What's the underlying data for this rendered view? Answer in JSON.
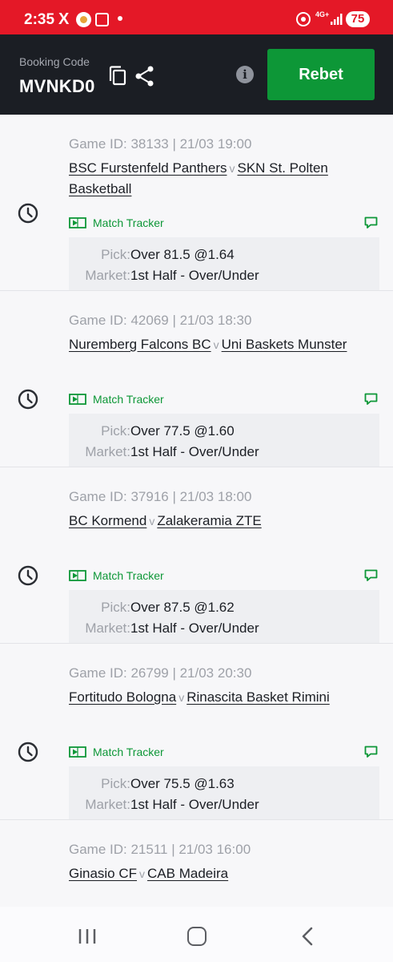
{
  "status_bar": {
    "time": "2:35",
    "x_glyph": "X",
    "network": "4G+",
    "battery": "75"
  },
  "header": {
    "booking_label": "Booking Code",
    "booking_code": "MVNKD0",
    "rebet_label": "Rebet",
    "info_glyph": "i"
  },
  "icons": {
    "clock": "clock-icon",
    "copy": "copy-icon",
    "share": "share-icon",
    "info": "info-icon",
    "tracker": "match-tracker-icon",
    "chat": "chat-icon"
  },
  "colors": {
    "accent_red": "#e41827",
    "header_bg": "#1b1e24",
    "green": "#0d9737"
  },
  "bets": [
    {
      "game_id": "Game ID: 38133 | 21/03 19:00",
      "home": "BSC Furstenfeld Panthers",
      "vs": "v",
      "away": "SKN St. Polten Basketball",
      "tracker": "Match Tracker",
      "pick_label": "Pick:",
      "pick": "Over 81.5 @1.64",
      "market_label": "Market:",
      "market": "1st Half - Over/Under"
    },
    {
      "game_id": "Game ID: 42069 | 21/03 18:30",
      "home": "Nuremberg Falcons BC",
      "vs": "v",
      "away": "Uni Baskets Munster",
      "tracker": "Match Tracker",
      "pick_label": "Pick:",
      "pick": "Over 77.5 @1.60",
      "market_label": "Market:",
      "market": "1st Half - Over/Under"
    },
    {
      "game_id": "Game ID: 37916 | 21/03 18:00",
      "home": "BC Kormend",
      "vs": "v",
      "away": "Zalakeramia ZTE",
      "tracker": "Match Tracker",
      "pick_label": "Pick:",
      "pick": "Over 87.5 @1.62",
      "market_label": "Market:",
      "market": "1st Half - Over/Under"
    },
    {
      "game_id": "Game ID: 26799 | 21/03 20:30",
      "home": "Fortitudo Bologna",
      "vs": "v",
      "away": "Rinascita Basket Rimini",
      "tracker": "Match Tracker",
      "pick_label": "Pick:",
      "pick": "Over 75.5 @1.63",
      "market_label": "Market:",
      "market": "1st Half - Over/Under"
    },
    {
      "game_id": "Game ID: 21511 | 21/03 16:00",
      "home": "Ginasio CF",
      "vs": "v",
      "away": "CAB Madeira"
    }
  ]
}
